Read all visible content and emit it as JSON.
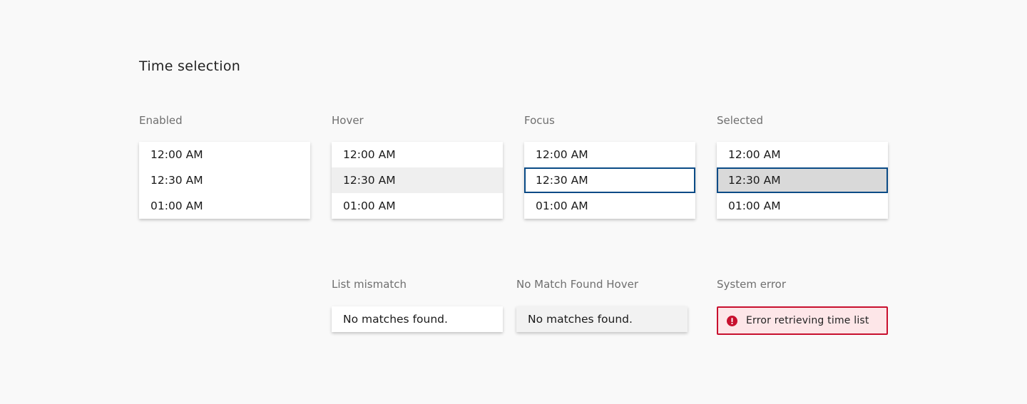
{
  "title": "Time selection",
  "states": [
    {
      "label": "Enabled",
      "items": [
        "12:00 AM",
        "12:30 AM",
        "01:00 AM"
      ]
    },
    {
      "label": "Hover",
      "items": [
        "12:00 AM",
        "12:30 AM",
        "01:00 AM"
      ]
    },
    {
      "label": "Focus",
      "items": [
        "12:00 AM",
        "12:30 AM",
        "01:00 AM"
      ]
    },
    {
      "label": "Selected",
      "items": [
        "12:00 AM",
        "12:30 AM",
        "01:00 AM"
      ]
    }
  ],
  "list_mismatch": {
    "label": "List mismatch",
    "message": "No matches found."
  },
  "no_match_hover": {
    "label": "No Match Found Hover",
    "message": "No matches found."
  },
  "system_error": {
    "label": "System error",
    "message": "Error retrieving time list",
    "icon": "error-icon"
  },
  "colors": {
    "focus_border": "#0a4b86",
    "error_border": "#c8102e",
    "error_background": "#fde6e8",
    "hover_background": "#efefef",
    "selected_background": "#d9d9d9"
  }
}
